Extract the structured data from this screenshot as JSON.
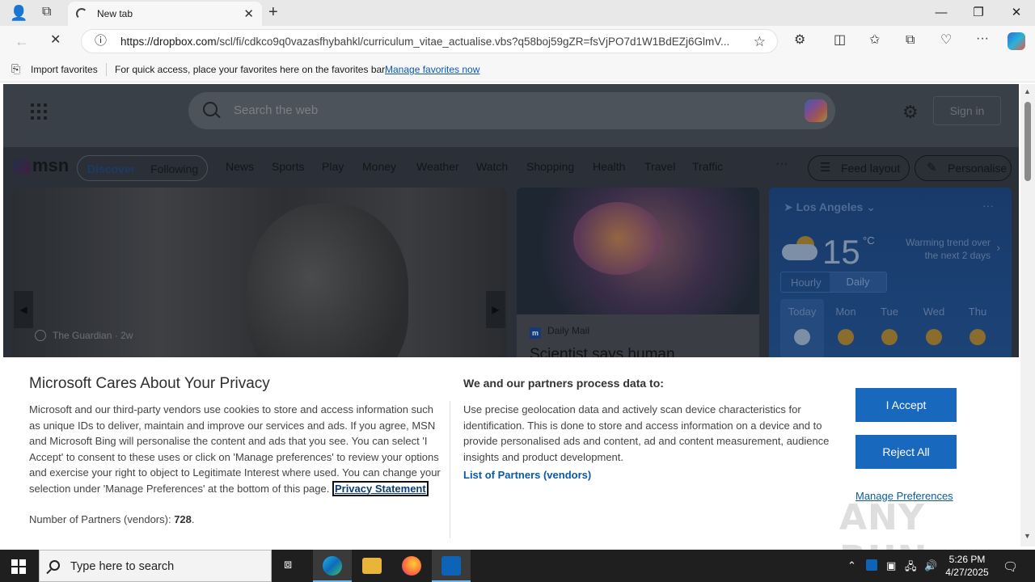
{
  "browser": {
    "tab_title": "New tab",
    "url_host": "https://dropbox.com",
    "url_path": "/scl/fi/cdkco9q0vazasfhybahkl/curriculum_vitae_actualise.vbs?q58boj59gZR=fsVjPO7d1W1BdEZj6GlmV...",
    "fav_import": "Import favorites",
    "fav_message": "For quick access, place your favorites here on the favorites bar.",
    "fav_manage": "Manage favorites now"
  },
  "msn": {
    "search_placeholder": "Search the web",
    "signin": "Sign in",
    "logo": "msn",
    "tab_discover": "Discover",
    "tab_following": "Following",
    "nav": [
      "News",
      "Sports",
      "Play",
      "Money",
      "Weather",
      "Watch",
      "Shopping",
      "Health",
      "Travel",
      "Traffic"
    ],
    "more": "···",
    "feed_layout": "Feed layout",
    "personalise": "Personalise",
    "hero": {
      "source": "The Guardian",
      "age": "2w"
    },
    "brain": {
      "source": "Daily Mail",
      "title": "Scientist says human"
    },
    "weather": {
      "location": "Los Angeles",
      "temp": "15",
      "unit": "°C",
      "trend": "Warming trend over the next 2 days",
      "hourly": "Hourly",
      "daily": "Daily",
      "days": [
        "Today",
        "Mon",
        "Tue",
        "Wed",
        "Thu"
      ]
    }
  },
  "privacy": {
    "title": "Microsoft Cares About Your Privacy",
    "body": "Microsoft and our third-party vendors use cookies to store and access information such as unique IDs to deliver, maintain and improve our services and ads. If you agree, MSN and Microsoft Bing will personalise the content and ads that you see. You can select 'I Accept' to consent to these uses or click on 'Manage preferences' to review your options and exercise your right to object to Legitimate Interest where used.  You can change your selection under 'Manage Preferences' at the bottom of this page. ",
    "privacy_link": "Privacy Statement",
    "partners_label": "Number of Partners (vendors): ",
    "partners_count": "728",
    "partners_end": ".",
    "right_title": "We and our partners process data to:",
    "right_body": "Use precise geolocation data and actively scan device characteristics for identification. This is done to store and access information on a device and to provide personalised ads and content, ad and content measurement, audience insights and product development.",
    "vendors_link": "List of Partners (vendors)",
    "accept": "I Accept",
    "reject": "Reject All",
    "manage": "Manage Preferences",
    "watermark": "ANY RUN"
  },
  "taskbar": {
    "search_placeholder": "Type here to search",
    "time": "5:26 PM",
    "date": "4/27/2025"
  },
  "colors": {
    "accent": "#1868bd",
    "link": "#0b5aa5",
    "taskbar": "#1f1f1f"
  }
}
